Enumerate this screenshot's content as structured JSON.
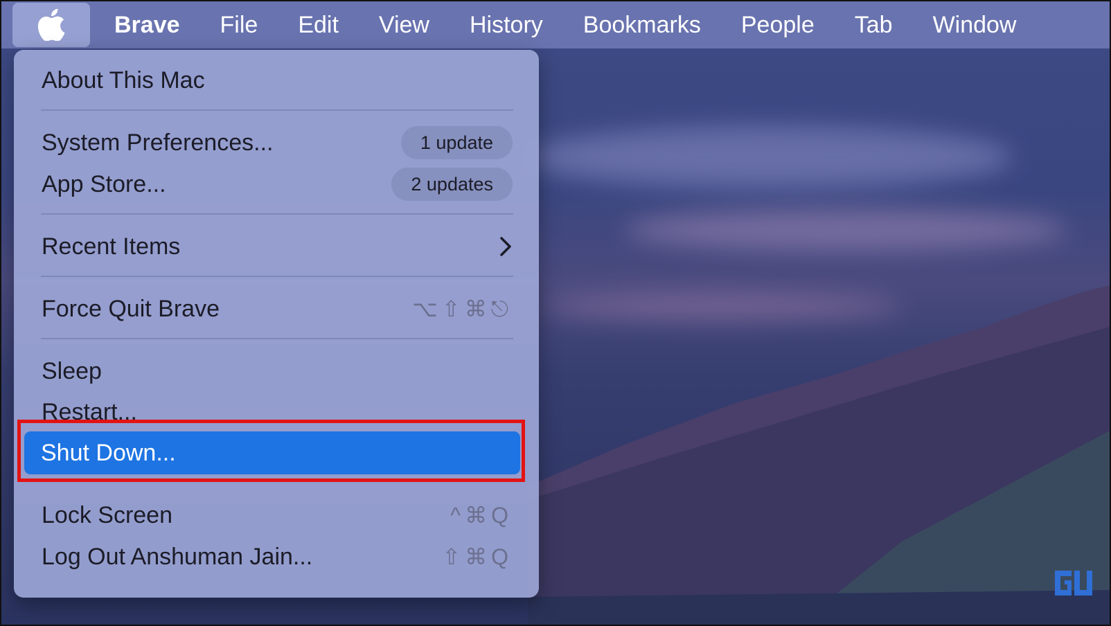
{
  "menubar": {
    "apple_icon": "apple-logo-icon",
    "app_name": "Brave",
    "items": [
      "File",
      "Edit",
      "View",
      "History",
      "Bookmarks",
      "People",
      "Tab",
      "Window"
    ]
  },
  "apple_menu": {
    "about": "About This Mac",
    "system_preferences": {
      "label": "System Preferences...",
      "badge": "1 update"
    },
    "app_store": {
      "label": "App Store...",
      "badge": "2 updates"
    },
    "recent_items": {
      "label": "Recent Items",
      "icon": "chevron-right-icon"
    },
    "force_quit": {
      "label": "Force Quit Brave",
      "shortcut": "⌥⇧⌘⎋"
    },
    "sleep": "Sleep",
    "restart": "Restart...",
    "shut_down": "Shut Down...",
    "lock_screen": {
      "label": "Lock Screen",
      "shortcut": "^⌘Q"
    },
    "log_out": {
      "label": "Log Out Anshuman Jain...",
      "shortcut": "⇧⌘Q"
    }
  },
  "colors": {
    "highlight": "#1e74e2",
    "annotation_box": "#e31313"
  }
}
